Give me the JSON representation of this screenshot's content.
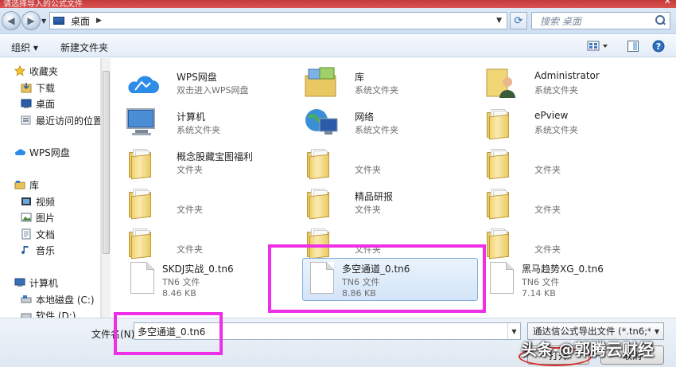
{
  "window": {
    "title": "请选择导入的公式文件",
    "close": "✕"
  },
  "address": {
    "path": "桌面",
    "search_placeholder": "搜索 桌面"
  },
  "toolbar": {
    "organize": "组织 ▾",
    "new_folder": "新建文件夹"
  },
  "nav": {
    "favorites": "收藏夹",
    "downloads": "下载",
    "desktop": "桌面",
    "recent": "最近访问的位置",
    "wps": "WPS网盘",
    "libraries": "库",
    "videos": "视频",
    "pictures": "图片",
    "documents": "文档",
    "music": "音乐",
    "computer": "计算机",
    "local_c": "本地磁盘 (C:)",
    "soft_d": "软件 (D:)"
  },
  "files": {
    "wps_name": "WPS网盘",
    "wps_sub": "双击进入WPS网盘",
    "lib_name": "库",
    "lib_sub": "系统文件夹",
    "admin_name": "Administrator",
    "admin_sub": "系统文件夹",
    "comp_name": "计算机",
    "comp_sub": "系统文件夹",
    "net_name": "网络",
    "net_sub": "系统文件夹",
    "epview_name": "ePview",
    "epview_sub": "系统文件夹",
    "f1_name": "概念股藏宝图福利",
    "f1_sub": "文件夹",
    "f2_sub": "文件夹",
    "f3_sub": "文件夹",
    "f4_sub": "文件夹",
    "f5_name": "精品研报",
    "f5_sub": "文件夹",
    "f6_sub": "文件夹",
    "f7_sub": "文件夹",
    "f8_sub": "文件夹",
    "f9_sub": "文件夹",
    "tn1_name": "SKDJ实战_0.tn6",
    "tn1_type": "TN6 文件",
    "tn1_size": "8.46 KB",
    "tn2_name": "多空通道_0.tn6",
    "tn2_type": "TN6 文件",
    "tn2_size": "8.86 KB",
    "tn3_name": "黑马趋势XG_0.tn6",
    "tn3_type": "TN6 文件",
    "tn3_size": "7.14 KB"
  },
  "bottom": {
    "filename_label": "文件名(N):",
    "filename_value": "多空通道_0.tn6",
    "filetype": "通达信公式导出文件 (*.tn6;*.tn",
    "open": "打开",
    "cancel": "取消"
  },
  "watermark": "头条 @郭腾云财经",
  "colors": {
    "highlight": "#ee2fe5",
    "selection": "#d3e5f8",
    "circle": "#d62b2b"
  }
}
